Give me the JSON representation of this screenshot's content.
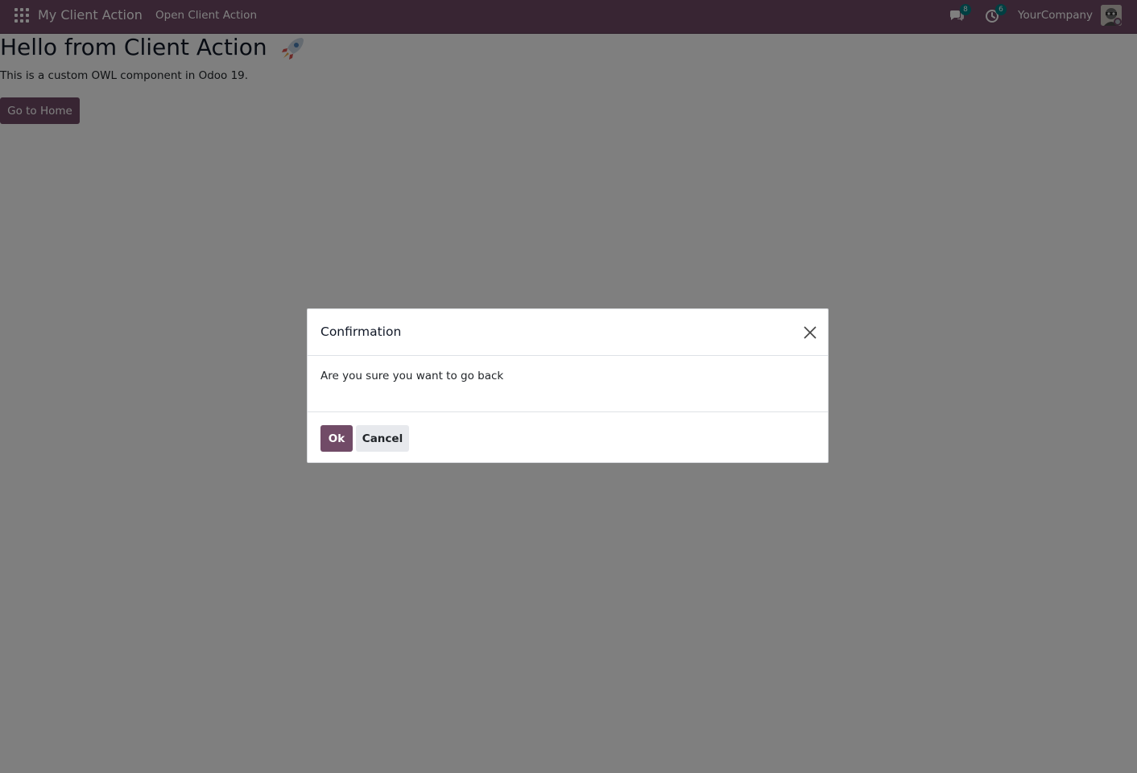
{
  "navbar": {
    "brand": "My Client Action",
    "menu_item": "Open Client Action",
    "messages_count": "8",
    "activities_count": "6",
    "company": "YourCompany",
    "icons": {
      "apps": "apps-grid-icon",
      "messages": "chat-bubbles-icon",
      "activities": "clock-icon",
      "avatar": "user-avatar"
    }
  },
  "page": {
    "heading": "Hello from Client Action",
    "heading_icon": "rocket-icon",
    "description": "This is a custom OWL component in Odoo 19.",
    "home_button_label": "Go to Home"
  },
  "dialog": {
    "title": "Confirmation",
    "message": "Are you sure you want to go back",
    "ok_label": "Ok",
    "cancel_label": "Cancel",
    "close_icon": "close-icon"
  },
  "colors": {
    "primary": "#714b67",
    "backdrop": "rgba(0,0,0,0.5)",
    "secondary_button": "#e7e9ed",
    "badge": "#017e84"
  }
}
